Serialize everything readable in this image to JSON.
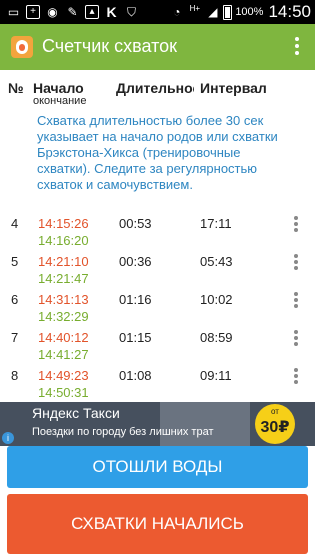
{
  "status_bar": {
    "icons": [
      "chat-icon",
      "plus-box-icon",
      "cat-icon",
      "wrench-icon",
      "image-icon",
      "k-icon",
      "shield-icon",
      "wifi-icon",
      "network-h-icon",
      "signal-icon",
      "battery-icon"
    ],
    "k_label": "K",
    "network_label": "H+",
    "battery": "100%",
    "time": "14:50"
  },
  "app_bar": {
    "title": "Счетчик схваток",
    "color": "#7fb63f"
  },
  "table": {
    "headers": {
      "num": "№",
      "start": "Начало",
      "start_sub": "окончание",
      "duration": "Длительность",
      "interval": "Интервал"
    },
    "tip": "Схватка длительностью более 30 сек указывает на начало родов или схватки Брэкстона-Хикса (тренировочные схватки). Следите за регулярностью схваток и самочувствием.",
    "rows": [
      {
        "num": "4",
        "start": "14:15:26",
        "end": "14:16:20",
        "duration": "00:53",
        "interval": "17:11"
      },
      {
        "num": "5",
        "start": "14:21:10",
        "end": "14:21:47",
        "duration": "00:36",
        "interval": "05:43"
      },
      {
        "num": "6",
        "start": "14:31:13",
        "end": "14:32:29",
        "duration": "01:16",
        "interval": "10:02"
      },
      {
        "num": "7",
        "start": "14:40:12",
        "end": "14:41:27",
        "duration": "01:15",
        "interval": "08:59"
      },
      {
        "num": "8",
        "start": "14:49:23",
        "end": "14:50:31",
        "duration": "01:08",
        "interval": "09:11"
      }
    ],
    "start_color": "#e2532a",
    "end_color": "#78ad2f",
    "tip_color": "#2e86c1"
  },
  "ad": {
    "title": "Яндекс Такси",
    "text": "Поездки по городу без лишних трат",
    "price_from": "от",
    "price": "30₽",
    "info": "i"
  },
  "buttons": {
    "waters": "ОТОШЛИ ВОДЫ",
    "contractions": "СХВАТКИ НАЧАЛИСЬ",
    "waters_color": "#2f9fe7",
    "contractions_color": "#ec5a30"
  }
}
